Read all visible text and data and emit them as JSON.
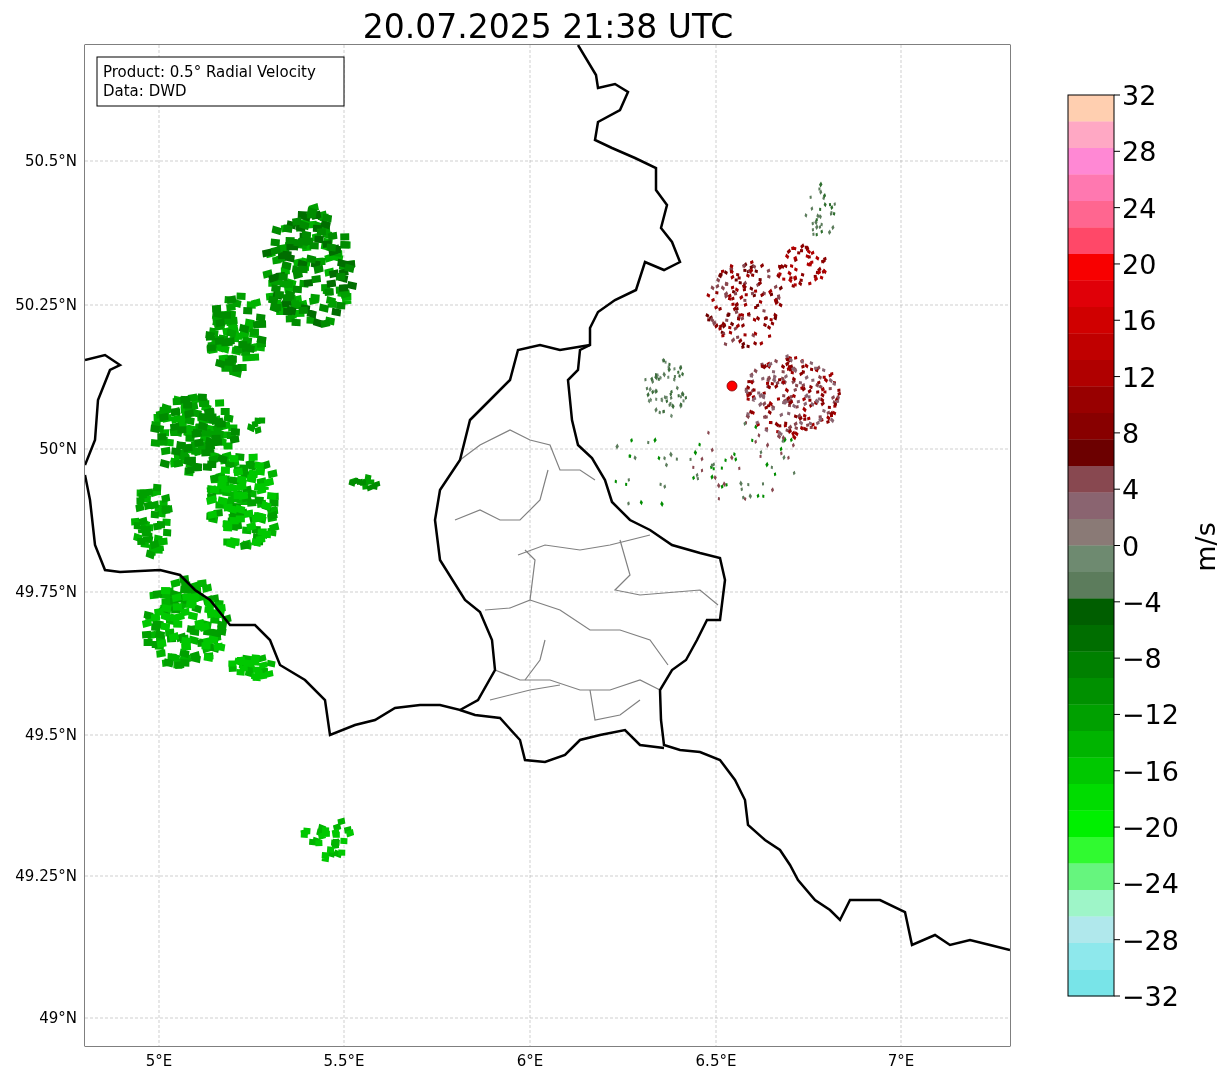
{
  "title": "20.07.2025 21:38 UTC",
  "info_box": {
    "lines": [
      "Product: 0.5° Radial Velocity",
      "Data: DWD"
    ]
  },
  "map": {
    "lat_ticks": [
      "50.5°N",
      "50.25°N",
      "50°N",
      "49.75°N",
      "49.5°N",
      "49.25°N",
      "49°N"
    ],
    "lon_ticks": [
      "5°E",
      "5.5°E",
      "6°E",
      "6.5°E",
      "7°E"
    ]
  },
  "colorbar": {
    "label": "m/s",
    "ticks": [
      "32",
      "28",
      "24",
      "20",
      "16",
      "12",
      "8",
      "4",
      "0",
      "−4",
      "−8",
      "−12",
      "−16",
      "−20",
      "−24",
      "−28",
      "−32"
    ],
    "segments": [
      {
        "color": "#ffcfb0"
      },
      {
        "color": "#ffa8c4"
      },
      {
        "color": "#ff88d4"
      },
      {
        "color": "#ff78b0"
      },
      {
        "color": "#ff6690"
      },
      {
        "color": "#ff4868"
      },
      {
        "color": "#f80000"
      },
      {
        "color": "#e00008"
      },
      {
        "color": "#d00000"
      },
      {
        "color": "#c00000"
      },
      {
        "color": "#b00000"
      },
      {
        "color": "#980000"
      },
      {
        "color": "#880000"
      },
      {
        "color": "#6c0000"
      },
      {
        "color": "#884850"
      },
      {
        "color": "#8a6470"
      },
      {
        "color": "#8a7a76"
      },
      {
        "color": "#6e8a70"
      },
      {
        "color": "#5c7c5c"
      },
      {
        "color": "#005e00"
      },
      {
        "color": "#006e00"
      },
      {
        "color": "#008000"
      },
      {
        "color": "#009000"
      },
      {
        "color": "#00a000"
      },
      {
        "color": "#00b400"
      },
      {
        "color": "#00c800"
      },
      {
        "color": "#00dc00"
      },
      {
        "color": "#00f000"
      },
      {
        "color": "#30fa30"
      },
      {
        "color": "#66f57e"
      },
      {
        "color": "#9ef5c8"
      },
      {
        "color": "#b0e8ec"
      },
      {
        "color": "#8ee8ec"
      },
      {
        "color": "#78e4e8"
      }
    ]
  }
}
